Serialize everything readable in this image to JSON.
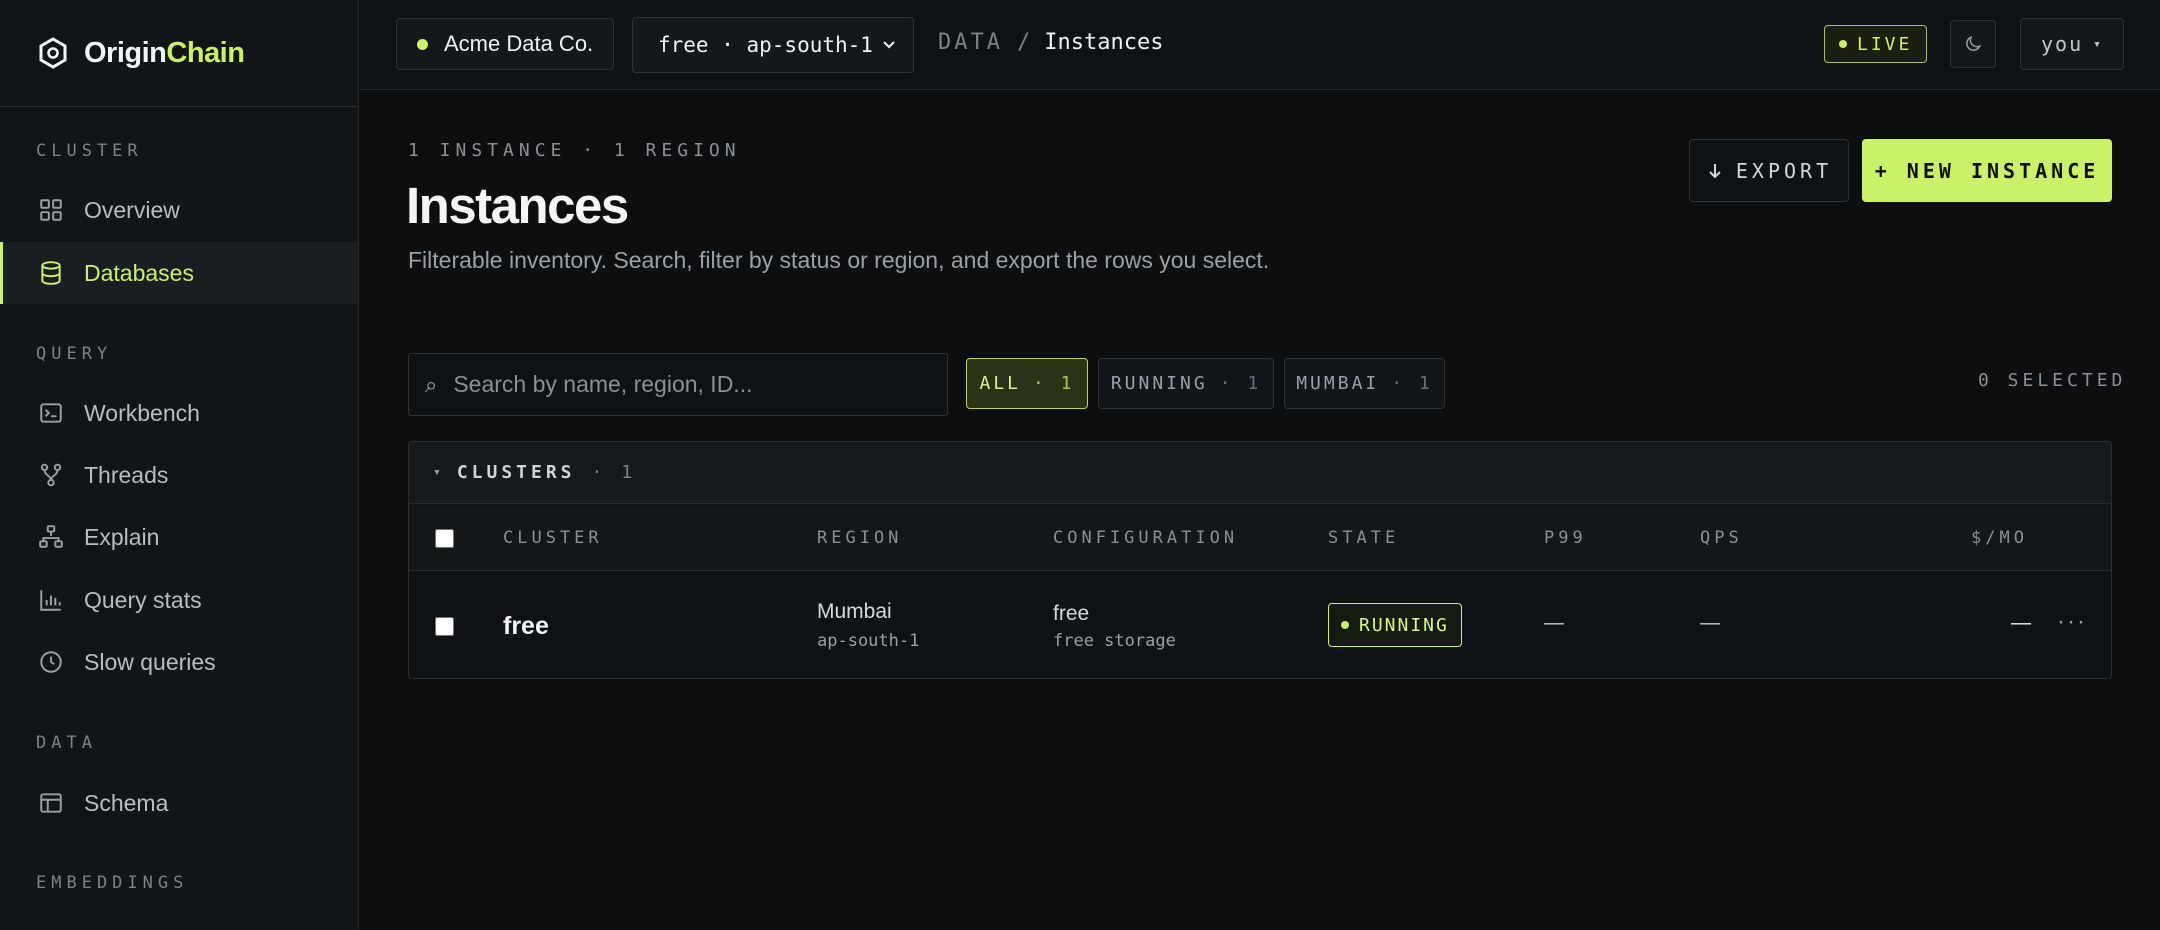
{
  "brand": {
    "part1": "Origin",
    "part2": "Chain"
  },
  "sidebar": {
    "sections": [
      {
        "label": "CLUSTER"
      },
      {
        "label": "QUERY"
      },
      {
        "label": "DATA"
      },
      {
        "label": "EMBEDDINGS"
      }
    ],
    "items": [
      {
        "label": "Overview",
        "icon": "grid-icon"
      },
      {
        "label": "Databases",
        "icon": "database-icon",
        "active": true
      },
      {
        "label": "Workbench",
        "icon": "terminal-icon"
      },
      {
        "label": "Threads",
        "icon": "branch-icon"
      },
      {
        "label": "Explain",
        "icon": "hierarchy-icon"
      },
      {
        "label": "Query stats",
        "icon": "bar-chart-icon"
      },
      {
        "label": "Slow queries",
        "icon": "clock-icon"
      },
      {
        "label": "Schema",
        "icon": "table-icon"
      }
    ]
  },
  "topbar": {
    "org": "Acme Data Co.",
    "env": "free · ap-south-1",
    "breadcrumb": {
      "section": "DATA",
      "separator": "/",
      "current": "Instances"
    },
    "live": "LIVE",
    "user": "you",
    "user_caret": "▾"
  },
  "header": {
    "eyebrow": "1 INSTANCE · 1 REGION",
    "title": "Instances",
    "subtitle": "Filterable inventory. Search, filter by status or region, and export the rows you select.",
    "export_label": "EXPORT",
    "new_label": "+ NEW INSTANCE"
  },
  "toolbar": {
    "search_placeholder": "Search by name, region, ID...",
    "search_glyph": "⌕",
    "chips": [
      {
        "label": "ALL",
        "count": "· 1",
        "active": true
      },
      {
        "label": "RUNNING",
        "count": "· 1"
      },
      {
        "label": "MUMBAI",
        "count": "· 1"
      }
    ],
    "selected": "0 SELECTED"
  },
  "table": {
    "group": {
      "toggle": "▾",
      "name": "CLUSTERS",
      "count": "· 1"
    },
    "columns": [
      "CLUSTER",
      "REGION",
      "CONFIGURATION",
      "STATE",
      "P99",
      "QPS",
      "$/MO"
    ],
    "rows": [
      {
        "name": "free",
        "region": "Mumbai",
        "region_code": "ap-south-1",
        "config": "free",
        "config_sub": "free storage",
        "state": "RUNNING",
        "p99": "—",
        "qps": "—",
        "cost": "—",
        "more": "···"
      }
    ]
  },
  "colors": {
    "accent": "#c9f26a",
    "bg": "#0c0e10",
    "sidebar": "#121518"
  }
}
